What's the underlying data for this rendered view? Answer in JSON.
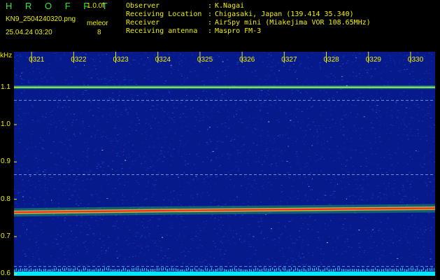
{
  "header": {
    "title": "H R O F F T",
    "version": "1.0.0f",
    "filename": "KN9_2504240320.png",
    "datetime": "25.04.24 03:20",
    "mode_label": "meleor",
    "mode_value": "8",
    "info": [
      {
        "key": "Observer",
        "value": "K.Nagai"
      },
      {
        "key": "Receiving Location",
        "value": "Chigasaki, Japan (139.414 35.340)"
      },
      {
        "key": "Receiver",
        "value": "AirSpy mini (Miakejima VOR 108.65MHz)"
      },
      {
        "key": "Receiving antenna",
        "value": "Maspro FM-3"
      }
    ],
    "separator": ":"
  },
  "chart_data": {
    "type": "heatmap",
    "ylabel": "kHz",
    "ylim": [
      0.595,
      1.195
    ],
    "yticks": [
      "1.1",
      "1.0",
      "0.9",
      "0.8",
      "0.7",
      "0.6"
    ],
    "ytick_values": [
      1.1,
      1.0,
      0.9,
      0.8,
      0.7,
      0.6
    ],
    "xticks": [
      "0321",
      "0322",
      "0323",
      "0324",
      "0325",
      "0326",
      "0327",
      "0328",
      "0329",
      "0330"
    ],
    "xlim_minutes": [
      0,
      10
    ],
    "signals": [
      {
        "kind": "strong_carrier",
        "freq_start": 0.765,
        "freq_end": 0.776,
        "intensity": "high"
      },
      {
        "kind": "carrier",
        "freq": 1.1,
        "intensity": "medium"
      },
      {
        "kind": "faint_line",
        "freq": 1.065,
        "intensity": "low"
      },
      {
        "kind": "faint_line",
        "freq": 0.866,
        "intensity": "low"
      },
      {
        "kind": "faint_line",
        "freq": 0.62,
        "intensity": "low"
      },
      {
        "kind": "faint_line",
        "freq": 0.61,
        "intensity": "low"
      }
    ],
    "colors": {
      "background": "#061a8c",
      "noise": "#1f4fd6",
      "carrier_core": "#ff2a1a",
      "carrier_halo": "#33e040",
      "line": "#9fe7ff",
      "baseline": "#00e8ff",
      "text": "#f0f000"
    }
  }
}
